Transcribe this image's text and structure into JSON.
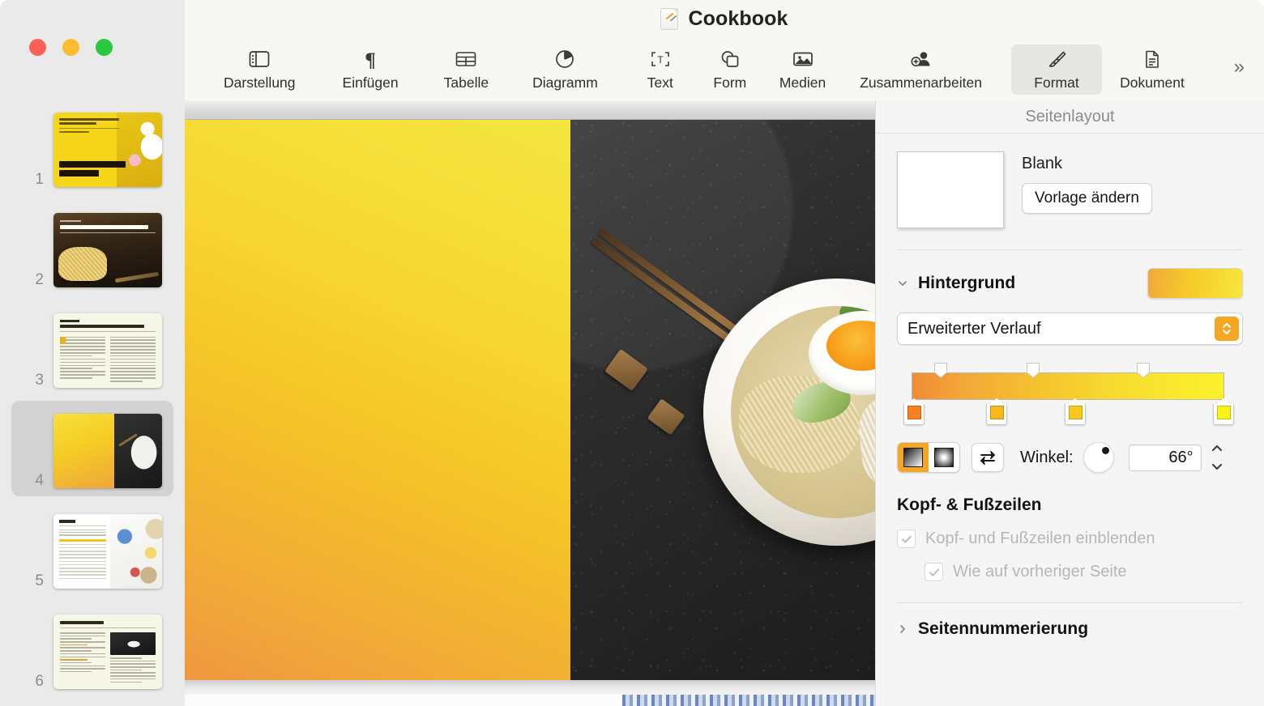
{
  "window": {
    "title": "Cookbook",
    "doc_icon": "pages-document-icon",
    "traffic_lights": [
      {
        "name": "close",
        "color": "#fc5f57"
      },
      {
        "name": "minimize",
        "color": "#fdbc2e"
      },
      {
        "name": "zoom",
        "color": "#28c840"
      }
    ]
  },
  "toolbar": {
    "items": [
      {
        "key": "darstellung",
        "label": "Darstellung",
        "icon": "sidebar-view-icon",
        "active": false
      },
      {
        "key": "einfuegen",
        "label": "Einfügen",
        "icon": "pilcrow-icon",
        "active": false
      },
      {
        "key": "tabelle",
        "label": "Tabelle",
        "icon": "table-grid-icon",
        "active": false
      },
      {
        "key": "diagramm",
        "label": "Diagramm",
        "icon": "pie-chart-icon",
        "active": false
      },
      {
        "key": "text",
        "label": "Text",
        "icon": "text-box-icon",
        "active": false
      },
      {
        "key": "form",
        "label": "Form",
        "icon": "shapes-icon",
        "active": false
      },
      {
        "key": "medien",
        "label": "Medien",
        "icon": "photo-icon",
        "active": false
      },
      {
        "key": "zusammen",
        "label": "Zusammenarbeiten",
        "icon": "add-person-icon",
        "active": false
      },
      {
        "key": "format",
        "label": "Format",
        "icon": "paintbrush-icon",
        "active": true
      },
      {
        "key": "dokument",
        "label": "Dokument",
        "icon": "document-icon",
        "active": false
      }
    ],
    "overflow_label": "»"
  },
  "navigator": {
    "pages": [
      {
        "number": "1",
        "kind": "cover-yellow-ramen",
        "selected": false
      },
      {
        "number": "2",
        "kind": "dark-noodles-photo",
        "selected": false
      },
      {
        "number": "3",
        "kind": "cream-two-column-text",
        "selected": false
      },
      {
        "number": "4",
        "kind": "yellow-gradient-and-bowl",
        "selected": true
      },
      {
        "number": "5",
        "kind": "recipe-table-and-ingredients",
        "selected": false
      },
      {
        "number": "6",
        "kind": "cream-list-with-photo",
        "selected": false
      }
    ]
  },
  "inspector": {
    "header": "Seitenlayout",
    "template": {
      "name": "Blank",
      "change_button": "Vorlage ändern"
    },
    "background": {
      "section_title": "Hintergrund",
      "expanded": true,
      "chevron": "chevron-down-icon",
      "swatch_colors": [
        "#f0a83a",
        "#f6c92a",
        "#f7e63c"
      ],
      "fill_type": "Erweiterter Verlauf",
      "gradient": {
        "stops": [
          {
            "position": 0,
            "color": "#f97f1f"
          },
          {
            "position": 27,
            "color": "#f9b81e"
          },
          {
            "position": 52,
            "color": "#fbc91c"
          },
          {
            "position": 100,
            "color": "#fbf318"
          }
        ],
        "opacity_markers": [
          9,
          40,
          75
        ],
        "type_selected": "linear",
        "type_options": [
          "linear",
          "radial"
        ],
        "swap_label": "swap-gradient-icon",
        "angle_label": "Winkel:",
        "angle_value": "66°"
      }
    },
    "headers_footers": {
      "section_title": "Kopf- & Fußzeilen",
      "options": [
        {
          "label": "Kopf- und Fußzeilen einblenden",
          "checked": true,
          "enabled": false
        },
        {
          "label": "Wie auf vorheriger Seite",
          "checked": true,
          "enabled": false
        }
      ]
    },
    "page_numbering": {
      "section_title": "Seitennummerierung",
      "expanded": false,
      "chevron": "chevron-right-icon"
    }
  },
  "canvas": {
    "current_page": {
      "left_panel_fill": "yellow-orange-gradient",
      "right_panel_image": "ramen-bowl-on-dark-stone"
    }
  }
}
